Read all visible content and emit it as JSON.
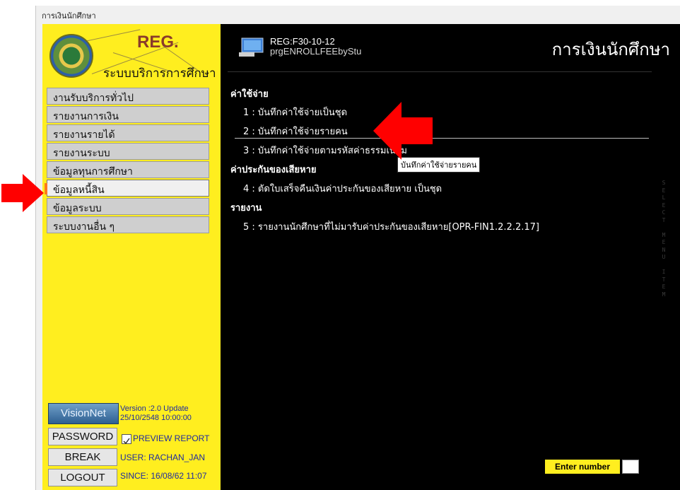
{
  "window": {
    "title": "การเงินนักศึกษา"
  },
  "logo": {
    "title": "REG.",
    "subtitle": "ระบบบริการการศึกษา"
  },
  "sidebar": {
    "items": [
      {
        "label": "งานรับบริการทั่วไป",
        "selected": false
      },
      {
        "label": "รายงานการเงิน",
        "selected": false
      },
      {
        "label": "รายงานรายได้",
        "selected": false
      },
      {
        "label": "รายงานระบบ",
        "selected": false
      },
      {
        "label": "ข้อมูลทุนการศึกษา",
        "selected": false
      },
      {
        "label": "ข้อมูลหนี้สิน",
        "selected": true
      },
      {
        "label": "ข้อมูลระบบ",
        "selected": false
      },
      {
        "label": "ระบบงานอื่น ๆ",
        "selected": false
      }
    ]
  },
  "footer": {
    "logo_text": "VisionNet",
    "version_line1": "Version :2.0 Update",
    "version_line2": "25/10/2548 10:00:00",
    "password_label": "PASSWORD",
    "break_label": "BREAK",
    "logout_label": "LOGOUT",
    "preview_label": "PREVIEW REPORT",
    "preview_checked": true,
    "user": "USER: RACHAN_JAN",
    "since": "SINCE: 16/08/62 11:07"
  },
  "main": {
    "program_code": "REG:F30-10-12",
    "program_name": "prgENROLLFEEbyStu",
    "title": "การเงินนักศึกษา",
    "sections": [
      {
        "heading": "ค่าใช้จ่าย",
        "options": [
          "1 : บันทึกค่าใช้จ่ายเป็นชุด",
          "2 : บันทึกค่าใช้จ่ายรายคน",
          "3 : บันทึกค่าใช้จ่ายตามรหัสค่าธรรมเนียม"
        ]
      },
      {
        "heading": "ค่าประกันของเสียหาย",
        "options": [
          "4 : ตัดใบเสร็จคืนเงินค่าประกันของเสียหาย เป็นชุด"
        ]
      },
      {
        "heading": "รายงาน",
        "options": [
          "5 : รายงานนักศึกษาที่ไม่มารับค่าประกันของเสียหาย[OPR-FIN1.2.2.2.17]"
        ]
      }
    ],
    "tooltip": "บันทึกค่าใช้จ่ายรายคน",
    "side_text": "SELECT MENU ITEM",
    "enter_label": "Enter number",
    "enter_value": ""
  },
  "colors": {
    "sidebar_bg": "#ffee1f",
    "main_bg": "#000000",
    "menu_item_bg": "#cfcfcf",
    "selected_marker": "#ff7a1a",
    "annotation_arrow": "#ff0000",
    "footer_text": "#1e2aa0"
  },
  "icons": {
    "program_icon": "computer-monitor-icon",
    "checkbox": "checkmark-icon",
    "annotation": "red-arrow-icon"
  }
}
